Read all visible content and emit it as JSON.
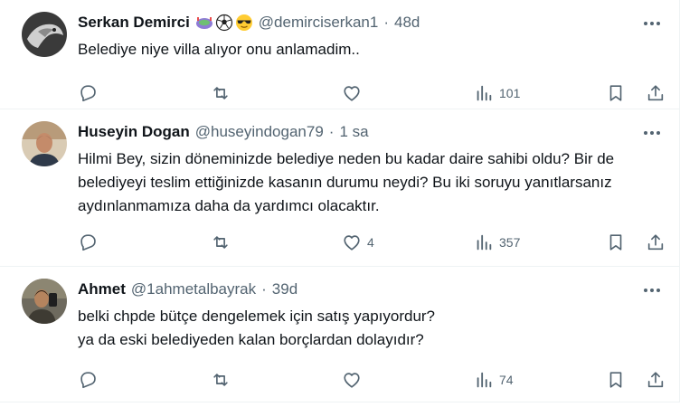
{
  "posts": [
    {
      "name": "Serkan Demirci",
      "badges": [
        "stadium-emoji",
        "soccer-ball-emoji",
        "sunglasses-emoji"
      ],
      "handle": "@demirciserkan1",
      "time": "48d",
      "text": "Belediye niye villa alıyor onu anlamadim..",
      "likes": "",
      "views": "101"
    },
    {
      "name": "Huseyin Dogan",
      "badges": [],
      "handle": "@huseyindogan79",
      "time": "1 sa",
      "text": "Hilmi Bey, sizin döneminizde belediye neden bu kadar daire sahibi oldu? Bir de belediyeyi teslim ettiğinizde kasanın durumu neydi? Bu iki soruyu yanıtlarsanız aydınlanmamıza daha da yardımcı olacaktır.",
      "likes": "4",
      "views": "357"
    },
    {
      "name": "Ahmet",
      "badges": [],
      "handle": "@1ahmetalbayrak",
      "time": "39d",
      "text": "belki chpde bütçe dengelemek için satış yapıyordur?\nya da eski belediyeden kalan borçlardan dolayıdır?",
      "likes": "",
      "views": "74"
    }
  ],
  "separator": "·",
  "colors": {
    "text": "#0f1419",
    "muted": "#536471",
    "border": "#eff3f4"
  }
}
